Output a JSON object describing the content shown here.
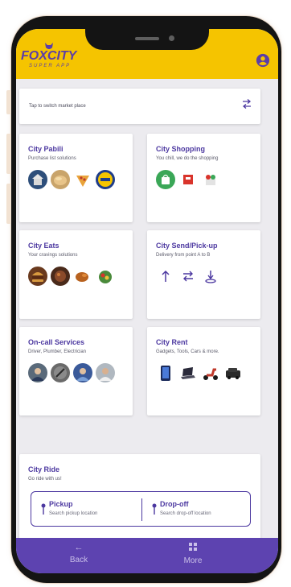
{
  "app": {
    "logo_text": "FOXCITY",
    "logo_tagline": "SUPER APP"
  },
  "header": {
    "profile_icon": "account-circle-icon"
  },
  "market": {
    "hint": "Tap to switch market place",
    "switch_icon": "swap-arrows-icon"
  },
  "tiles": [
    {
      "title": "City Pabili",
      "subtitle": "Purchase list solutions",
      "icons": [
        "store-thumb-icon",
        "bread-thumb-icon",
        "pizza-slice-icon",
        "brand-logo-icon"
      ]
    },
    {
      "title": "City Shopping",
      "subtitle": "You chill, we do the shopping",
      "icons": [
        "grocery-bag-icon",
        "shop-logo-icon",
        "gift-icon"
      ]
    },
    {
      "title": "City Eats",
      "subtitle": "Your cravings solutions",
      "icons": [
        "burger-icon",
        "food-plate-icon",
        "fried-chicken-icon",
        "salad-bowl-icon"
      ]
    },
    {
      "title": "City Send/Pick-up",
      "subtitle": "Delivery from point A to B",
      "icons": [
        "upload-arrow-icon",
        "exchange-arrows-icon",
        "pickup-location-icon"
      ]
    },
    {
      "title": "On-call Services",
      "subtitle": "Driver, Plumber, Electrician",
      "icons": [
        "person-photo-icon",
        "tools-photo-icon",
        "worker-photo-icon",
        "technician-photo-icon"
      ]
    },
    {
      "title": "City Rent",
      "subtitle": "Gadgets, Tools, Cars & more.",
      "icons": [
        "phone-gadget-icon",
        "laptop-icon",
        "scooter-icon",
        "car-icon"
      ]
    }
  ],
  "ride": {
    "title": "City Ride",
    "subtitle": "Go ride with us!",
    "pickup": {
      "label": "Pickup",
      "placeholder": "Search pickup location"
    },
    "dropoff": {
      "label": "Drop-off",
      "placeholder": "Search drop-off location"
    }
  },
  "nav": {
    "back": "Back",
    "more": "More"
  },
  "colors": {
    "header": "#f5c400",
    "brand": "#5b3ea8",
    "bottom_nav": "#5d43b0"
  }
}
